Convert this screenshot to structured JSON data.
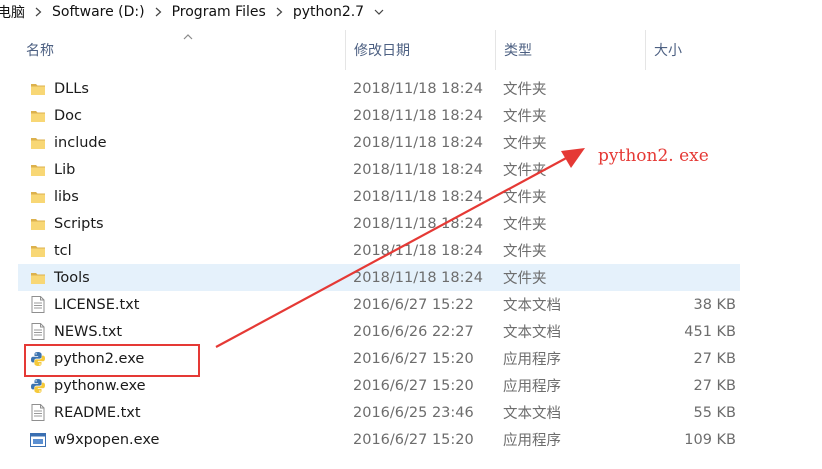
{
  "breadcrumb": {
    "items": [
      "电脑",
      "Software (D:)",
      "Program Files",
      "python2.7"
    ]
  },
  "columns": {
    "name": "名称",
    "date": "修改日期",
    "type": "类型",
    "size": "大小"
  },
  "files": [
    {
      "name": "DLLs",
      "date": "2018/11/18 18:24",
      "type": "文件夹",
      "size": "",
      "icon": "folder-icon"
    },
    {
      "name": "Doc",
      "date": "2018/11/18 18:24",
      "type": "文件夹",
      "size": "",
      "icon": "folder-icon"
    },
    {
      "name": "include",
      "date": "2018/11/18 18:24",
      "type": "文件夹",
      "size": "",
      "icon": "folder-icon"
    },
    {
      "name": "Lib",
      "date": "2018/11/18 18:24",
      "type": "文件夹",
      "size": "",
      "icon": "folder-icon"
    },
    {
      "name": "libs",
      "date": "2018/11/18 18:24",
      "type": "文件夹",
      "size": "",
      "icon": "folder-icon"
    },
    {
      "name": "Scripts",
      "date": "2018/11/18 18:24",
      "type": "文件夹",
      "size": "",
      "icon": "folder-icon"
    },
    {
      "name": "tcl",
      "date": "2018/11/18 18:24",
      "type": "文件夹",
      "size": "",
      "icon": "folder-icon"
    },
    {
      "name": "Tools",
      "date": "2018/11/18 18:24",
      "type": "文件夹",
      "size": "",
      "icon": "folder-icon"
    },
    {
      "name": "LICENSE.txt",
      "date": "2016/6/27 15:22",
      "type": "文本文档",
      "size": "38 KB",
      "icon": "text-file-icon"
    },
    {
      "name": "NEWS.txt",
      "date": "2016/6/26 22:27",
      "type": "文本文档",
      "size": "451 KB",
      "icon": "text-file-icon"
    },
    {
      "name": "python2.exe",
      "date": "2016/6/27 15:20",
      "type": "应用程序",
      "size": "27 KB",
      "icon": "python-icon"
    },
    {
      "name": "pythonw.exe",
      "date": "2016/6/27 15:20",
      "type": "应用程序",
      "size": "27 KB",
      "icon": "python-icon"
    },
    {
      "name": "README.txt",
      "date": "2016/6/25 23:46",
      "type": "文本文档",
      "size": "55 KB",
      "icon": "text-file-icon"
    },
    {
      "name": "w9xpopen.exe",
      "date": "2016/6/27 15:20",
      "type": "应用程序",
      "size": "109 KB",
      "icon": "exe-window-icon"
    }
  ],
  "selected_row": "Tools",
  "annotation": {
    "label": "python2. exe",
    "color": "#e53935"
  },
  "colors": {
    "folder": "#f8d775",
    "selection": "#e5f1fb",
    "header_text": "#4d6082",
    "secondary_text": "#6d6d6d"
  }
}
